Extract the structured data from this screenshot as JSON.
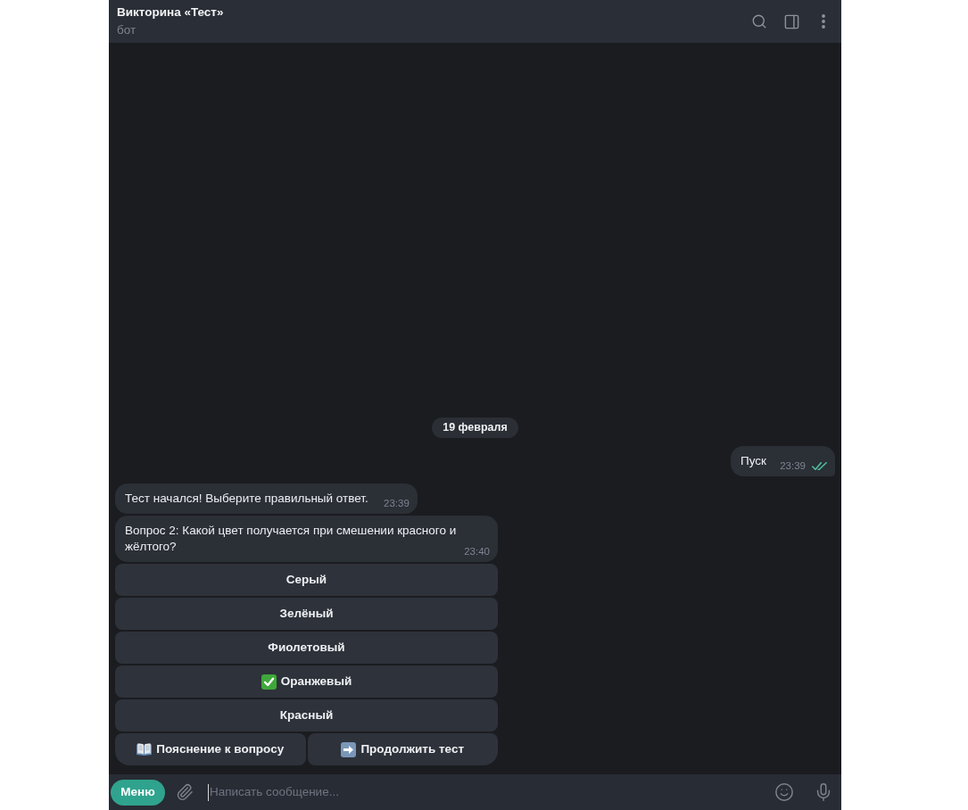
{
  "chat_header": {
    "title": "Викторина «Тест»",
    "subtitle": "бот"
  },
  "date_divider": "19 февраля",
  "messages": [
    {
      "kind": "outgoing",
      "text": "Пуск",
      "time": "23:39",
      "read": true
    },
    {
      "kind": "incoming",
      "text": "Тест начался! Выберите правильный ответ.",
      "time": "23:39"
    },
    {
      "kind": "incoming",
      "text": "Вопрос 2: Какой цвет получается при смешении красного и жёлтого?",
      "time": "23:40"
    }
  ],
  "answer_buttons": [
    {
      "label": "Серый",
      "selected": false
    },
    {
      "label": "Зелёный",
      "selected": false
    },
    {
      "label": "Фиолетовый",
      "selected": false
    },
    {
      "label": "Оранжевый",
      "selected": true
    },
    {
      "label": "Красный",
      "selected": false
    }
  ],
  "action_buttons": [
    {
      "kind": "explanation",
      "label": "Пояснение к вопросу"
    },
    {
      "kind": "continue",
      "label": "Продолжить тест"
    }
  ],
  "composer": {
    "menu_button": "Меню",
    "placeholder": "Написать сообщение..."
  }
}
